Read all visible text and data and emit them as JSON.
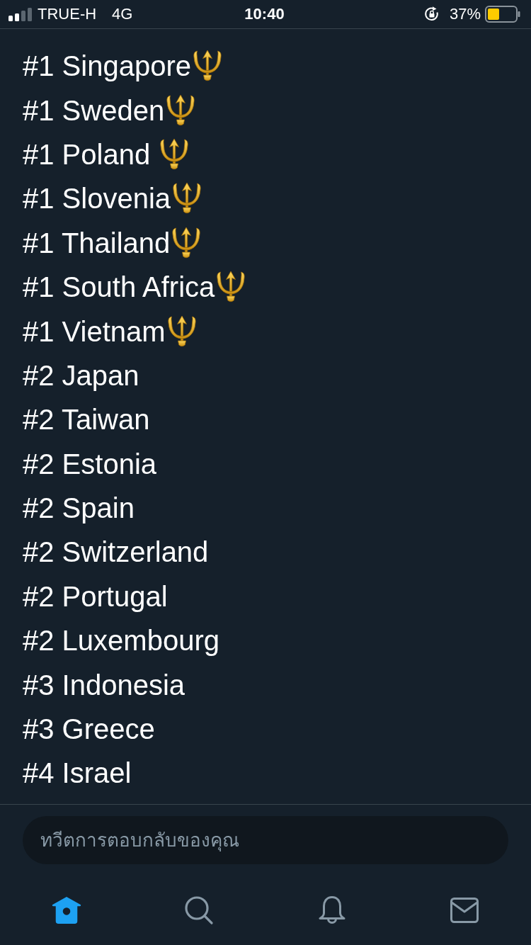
{
  "status_bar": {
    "carrier": "TRUE-H",
    "network": "4G",
    "time": "10:40",
    "battery": "37%"
  },
  "lines": [
    {
      "text": "#1 Singapore",
      "emoji": true
    },
    {
      "text": "#1 Sweden",
      "emoji": true
    },
    {
      "text": "#1 Poland ",
      "emoji": true
    },
    {
      "text": "#1 Slovenia",
      "emoji": true
    },
    {
      "text": "#1 Thailand",
      "emoji": true
    },
    {
      "text": "#1 South Africa",
      "emoji": true
    },
    {
      "text": "#1 Vietnam",
      "emoji": true
    },
    {
      "text": "#2 Japan",
      "emoji": false
    },
    {
      "text": "#2 Taiwan",
      "emoji": false
    },
    {
      "text": "#2 Estonia",
      "emoji": false
    },
    {
      "text": "#2 Spain",
      "emoji": false
    },
    {
      "text": "#2 Switzerland",
      "emoji": false
    },
    {
      "text": "#2 Portugal",
      "emoji": false
    },
    {
      "text": "#2 Luxembourg",
      "emoji": false
    },
    {
      "text": "#3 Indonesia",
      "emoji": false
    },
    {
      "text": "#3 Greece",
      "emoji": false
    },
    {
      "text": "#4 Israel",
      "emoji": false
    }
  ],
  "reply_field": {
    "placeholder": "ทวีตการตอบกลับของคุณ"
  },
  "tab_bar": [
    {
      "kind": "home",
      "selected": true
    },
    {
      "kind": "search",
      "selected": false
    },
    {
      "kind": "notifications",
      "selected": false
    },
    {
      "kind": "messages",
      "selected": false
    }
  ]
}
